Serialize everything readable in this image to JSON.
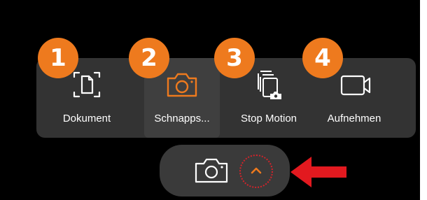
{
  "modes": [
    {
      "number": "1",
      "label": "Dokument",
      "icon": "document-scan-icon",
      "selected": false
    },
    {
      "number": "2",
      "label": "Schnapps...",
      "icon": "camera-icon",
      "selected": true
    },
    {
      "number": "3",
      "label": "Stop Motion",
      "icon": "stop-motion-icon",
      "selected": false
    },
    {
      "number": "4",
      "label": "Aufnehmen",
      "icon": "video-camera-icon",
      "selected": false
    }
  ],
  "shutter": {
    "icon": "camera-icon",
    "expand_icon": "chevron-up-icon"
  },
  "annotation": {
    "arrow_icon": "red-arrow-left-icon"
  },
  "colors": {
    "accent_orange": "#ee7a1e",
    "annotation_red": "#d4232a",
    "panel": "#333333",
    "selected_tile": "#3f3f3f"
  }
}
